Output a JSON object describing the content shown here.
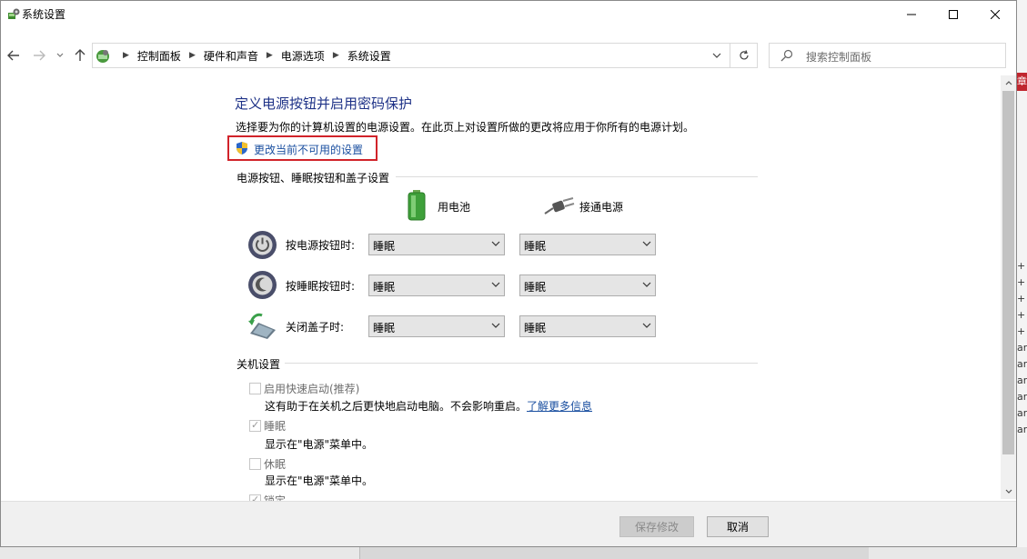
{
  "window": {
    "title": "系统设置"
  },
  "address_bar": {
    "breadcrumbs": [
      "控制面板",
      "硬件和声音",
      "电源选项",
      "系统设置"
    ]
  },
  "search": {
    "placeholder": "搜索控制面板"
  },
  "main": {
    "heading": "定义电源按钮并启用密码保护",
    "description": "选择要为你的计算机设置的电源设置。在此页上对设置所做的更改将应用于你所有的电源计划。",
    "change_settings_link": "更改当前不可用的设置"
  },
  "power_buttons": {
    "section_title": "电源按钮、睡眠按钮和盖子设置",
    "columns": {
      "battery": "用电池",
      "plugged_in": "接通电源"
    },
    "rows": [
      {
        "label": "按电源按钮时:",
        "battery": "睡眠",
        "plugged_in": "睡眠"
      },
      {
        "label": "按睡眠按钮时:",
        "battery": "睡眠",
        "plugged_in": "睡眠"
      },
      {
        "label": "关闭盖子时:",
        "battery": "睡眠",
        "plugged_in": "睡眠"
      }
    ]
  },
  "shutdown": {
    "section_title": "关机设置",
    "items": [
      {
        "label": "启用快速启动(推荐)",
        "checked": false,
        "description": "这有助于在关机之后更快地启动电脑。不会影响重启。",
        "link": "了解更多信息"
      },
      {
        "label": "睡眠",
        "checked": true,
        "description": "显示在\"电源\"菜单中。"
      },
      {
        "label": "休眠",
        "checked": false,
        "description": "显示在\"电源\"菜单中。"
      },
      {
        "label": "锁定",
        "checked": true
      }
    ]
  },
  "footer": {
    "save_label": "保存修改",
    "cancel_label": "取消"
  },
  "background": {
    "badge": "章",
    "marks": [
      "+",
      "+",
      "+",
      "+",
      "+",
      "ar",
      "ar",
      "ar",
      "ar",
      "ar",
      "ar"
    ]
  },
  "colors": {
    "heading": "#1e3287",
    "link": "#1a4fa0",
    "highlight_box": "#d1232a"
  }
}
